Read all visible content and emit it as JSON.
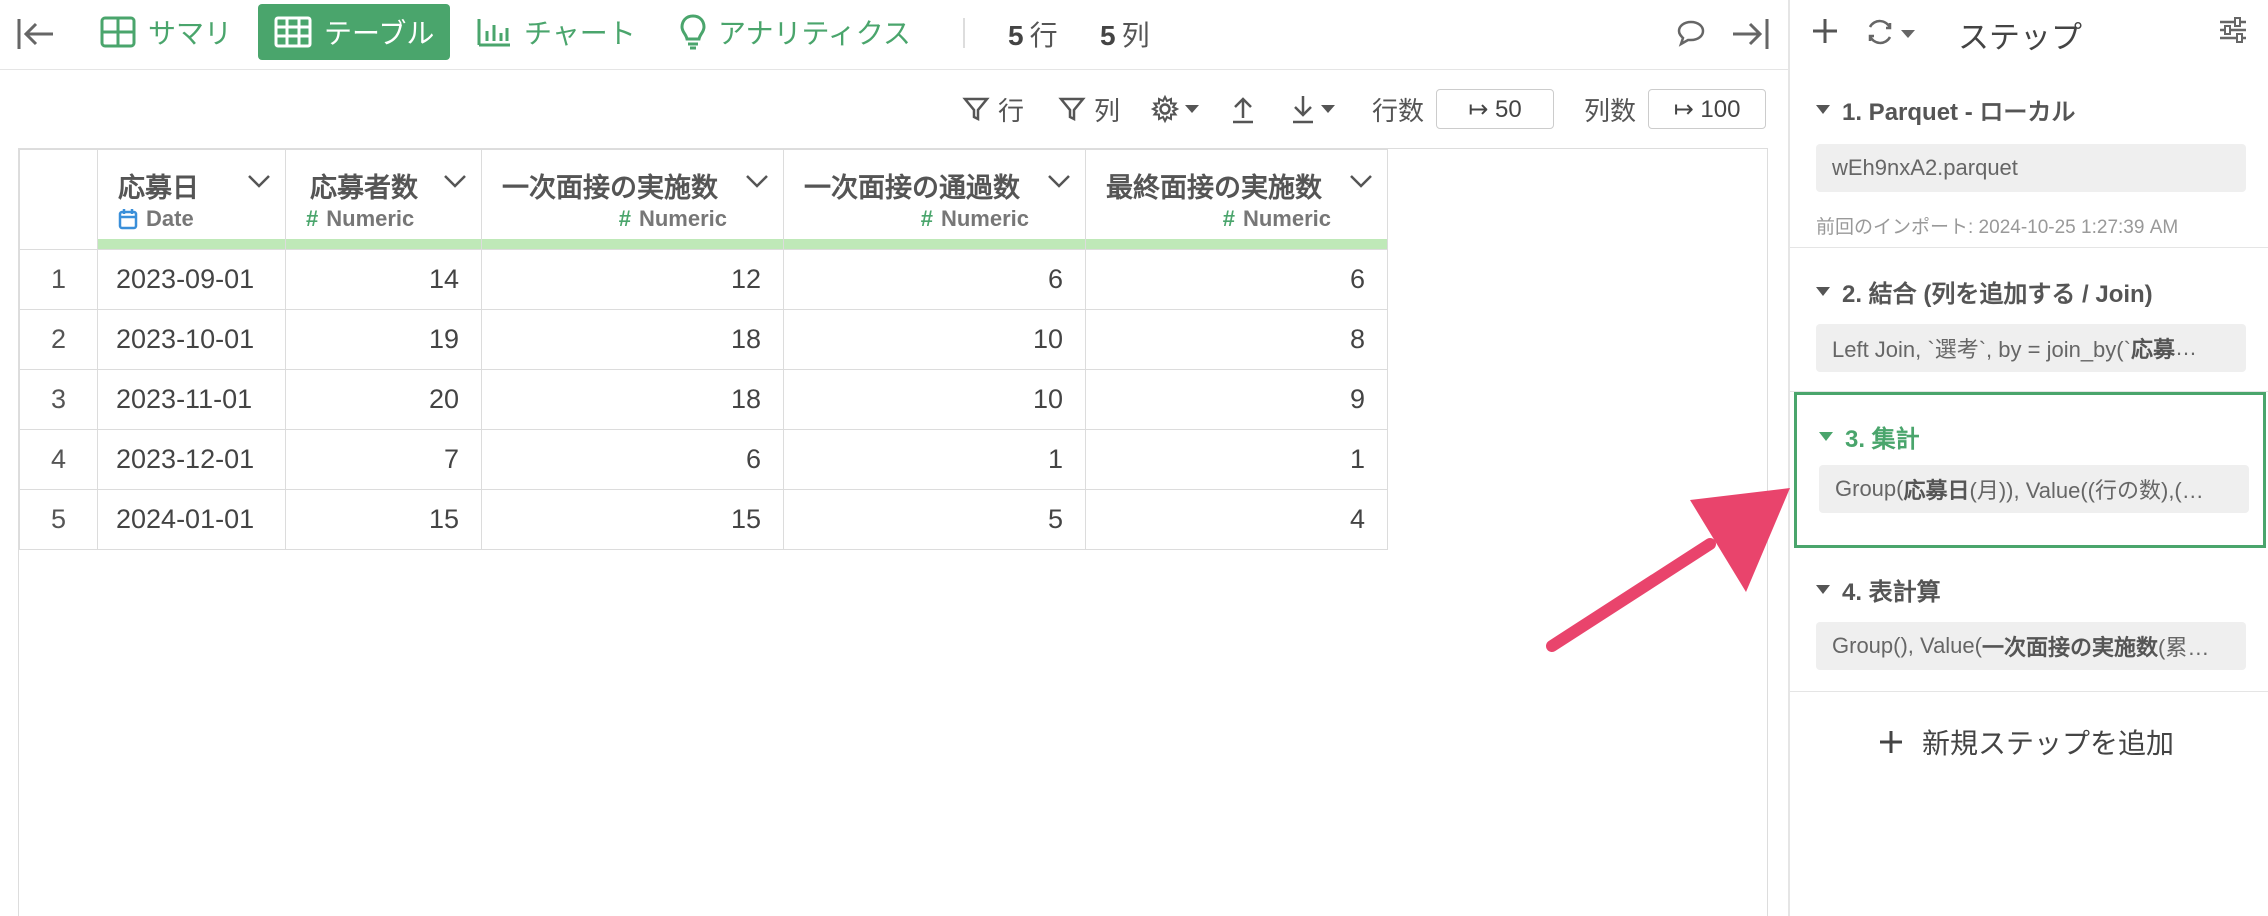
{
  "toolbar": {
    "tabs": [
      {
        "label": "サマリ",
        "icon": "summary-grid-icon"
      },
      {
        "label": "テーブル",
        "icon": "table-icon",
        "active": true
      },
      {
        "label": "チャート",
        "icon": "bar-chart-icon"
      },
      {
        "label": "アナリティクス",
        "icon": "lightbulb-icon"
      }
    ],
    "rows_count": "5",
    "rows_unit": "行",
    "cols_count": "5",
    "cols_unit": "列"
  },
  "subtoolbar": {
    "filter_rows": "行",
    "filter_cols": "列",
    "rows_label": "行数",
    "rows_value": "↦ 50",
    "cols_label": "列数",
    "cols_value": "↦ 100"
  },
  "table": {
    "columns": [
      {
        "name": "応募日",
        "type": "Date",
        "type_icon": "calendar-icon"
      },
      {
        "name": "応募者数",
        "type": "Numeric",
        "type_icon": "hash-icon"
      },
      {
        "name": "一次面接の実施数",
        "type": "Numeric",
        "type_icon": "hash-icon"
      },
      {
        "name": "一次面接の通過数",
        "type": "Numeric",
        "type_icon": "hash-icon"
      },
      {
        "name": "最終面接の実施数",
        "type": "Numeric",
        "type_icon": "hash-icon"
      }
    ],
    "rows": [
      [
        "1",
        "2023-09-01",
        "14",
        "12",
        "6",
        "6"
      ],
      [
        "2",
        "2023-10-01",
        "19",
        "18",
        "10",
        "8"
      ],
      [
        "3",
        "2023-11-01",
        "20",
        "18",
        "10",
        "9"
      ],
      [
        "4",
        "2023-12-01",
        "7",
        "6",
        "1",
        "1"
      ],
      [
        "5",
        "2024-01-01",
        "15",
        "15",
        "5",
        "4"
      ]
    ]
  },
  "sidebar": {
    "title": "ステップ",
    "steps": [
      {
        "title": "1. Parquet - ローカル",
        "detail": "wEh9nxA2.parquet",
        "meta": "前回のインポート: 2024-10-25 1:27:39 AM"
      },
      {
        "title": "2. 結合 (列を追加する / Join)",
        "detail_pre": "Left Join, `選考`, by = join_by(`",
        "detail_bold": "応募",
        "detail_post": "…"
      },
      {
        "title": "3. 集計",
        "detail_pre": "Group(",
        "detail_bold": "応募日",
        "detail_post": " (月)), Value((行の数),(…",
        "active": true
      },
      {
        "title": "4. 表計算",
        "detail_pre": "Group(), Value(",
        "detail_bold": "一次面接の実施数",
        "detail_post": " (累…"
      }
    ],
    "add_step": "新規ステップを追加"
  },
  "colors": {
    "accent": "#4aa56c",
    "header_bar": "#bfe9b8",
    "arrow": "#e9446c",
    "date_icon": "#3a8fd9"
  }
}
